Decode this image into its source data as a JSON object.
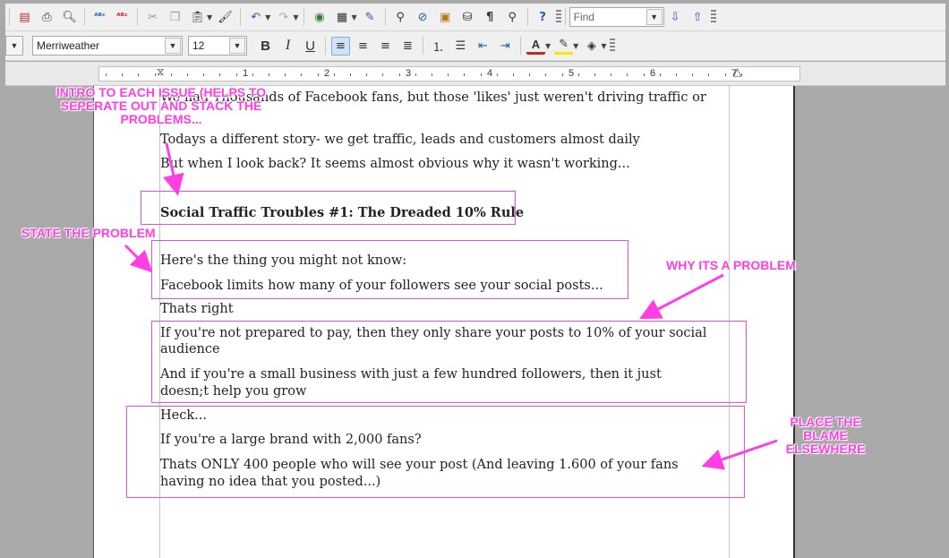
{
  "toolbar_top": {
    "find_placeholder": "Find",
    "icons": [
      "pdf-icon",
      "print-icon",
      "print-preview-icon",
      "spellcheck-icon",
      "autocheck-icon",
      "cut-icon",
      "copy-icon",
      "paste-icon",
      "clone-format-icon",
      "undo-icon",
      "redo-icon",
      "navigator-icon",
      "table-icon",
      "draw-icon",
      "find-replace-icon",
      "hyperlink-icon",
      "gallery-icon",
      "database-icon",
      "formatting-marks-icon",
      "zoom-icon",
      "help-icon"
    ]
  },
  "toolbar_format": {
    "font_name": "Merriweather",
    "font_size": "12",
    "bold_label": "B",
    "italic_label": "I",
    "underline_label": "U"
  },
  "ruler": {
    "numbers": [
      "1",
      "2",
      "3",
      "4",
      "5",
      "6",
      "7"
    ]
  },
  "document": {
    "lines": [
      "We had Thousands of Facebook fans, but those 'likes' just weren't driving traffic or",
      "Todays a different story- we get traffic, leads and customers almost daily",
      "But when I look back? It seems almost obvious why it wasn't working...",
      "Social Traffic Troubles #1: The Dreaded 10% Rule",
      "Here's the thing you might not know:",
      "Facebook limits how many of your followers see your social posts...",
      "Thats right",
      "If you're not prepared to pay, then they only share your posts to 10% of your social",
      "audience",
      "And if you're a small business with just a few hundred followers, then it just",
      "doesn;t help you grow",
      "Heck...",
      "If you're a large brand with 2,000 fans?",
      "Thats ONLY 400 people who will see your post (And leaving 1.600 of your fans",
      "having no idea that you posted...)"
    ]
  },
  "annotations": {
    "intro": [
      "INTRO TO EACH ISSUE (HELPS TO",
      "SEPERATE OUT AND STACK THE",
      "PROBLEMS..."
    ],
    "state": "STATE THE PROBLEM",
    "why": "WHY ITS A PROBLEM",
    "blame": [
      "PLACE THE",
      "BLAME",
      "ELSEWHERE"
    ],
    "color": "#ff3fe3"
  }
}
